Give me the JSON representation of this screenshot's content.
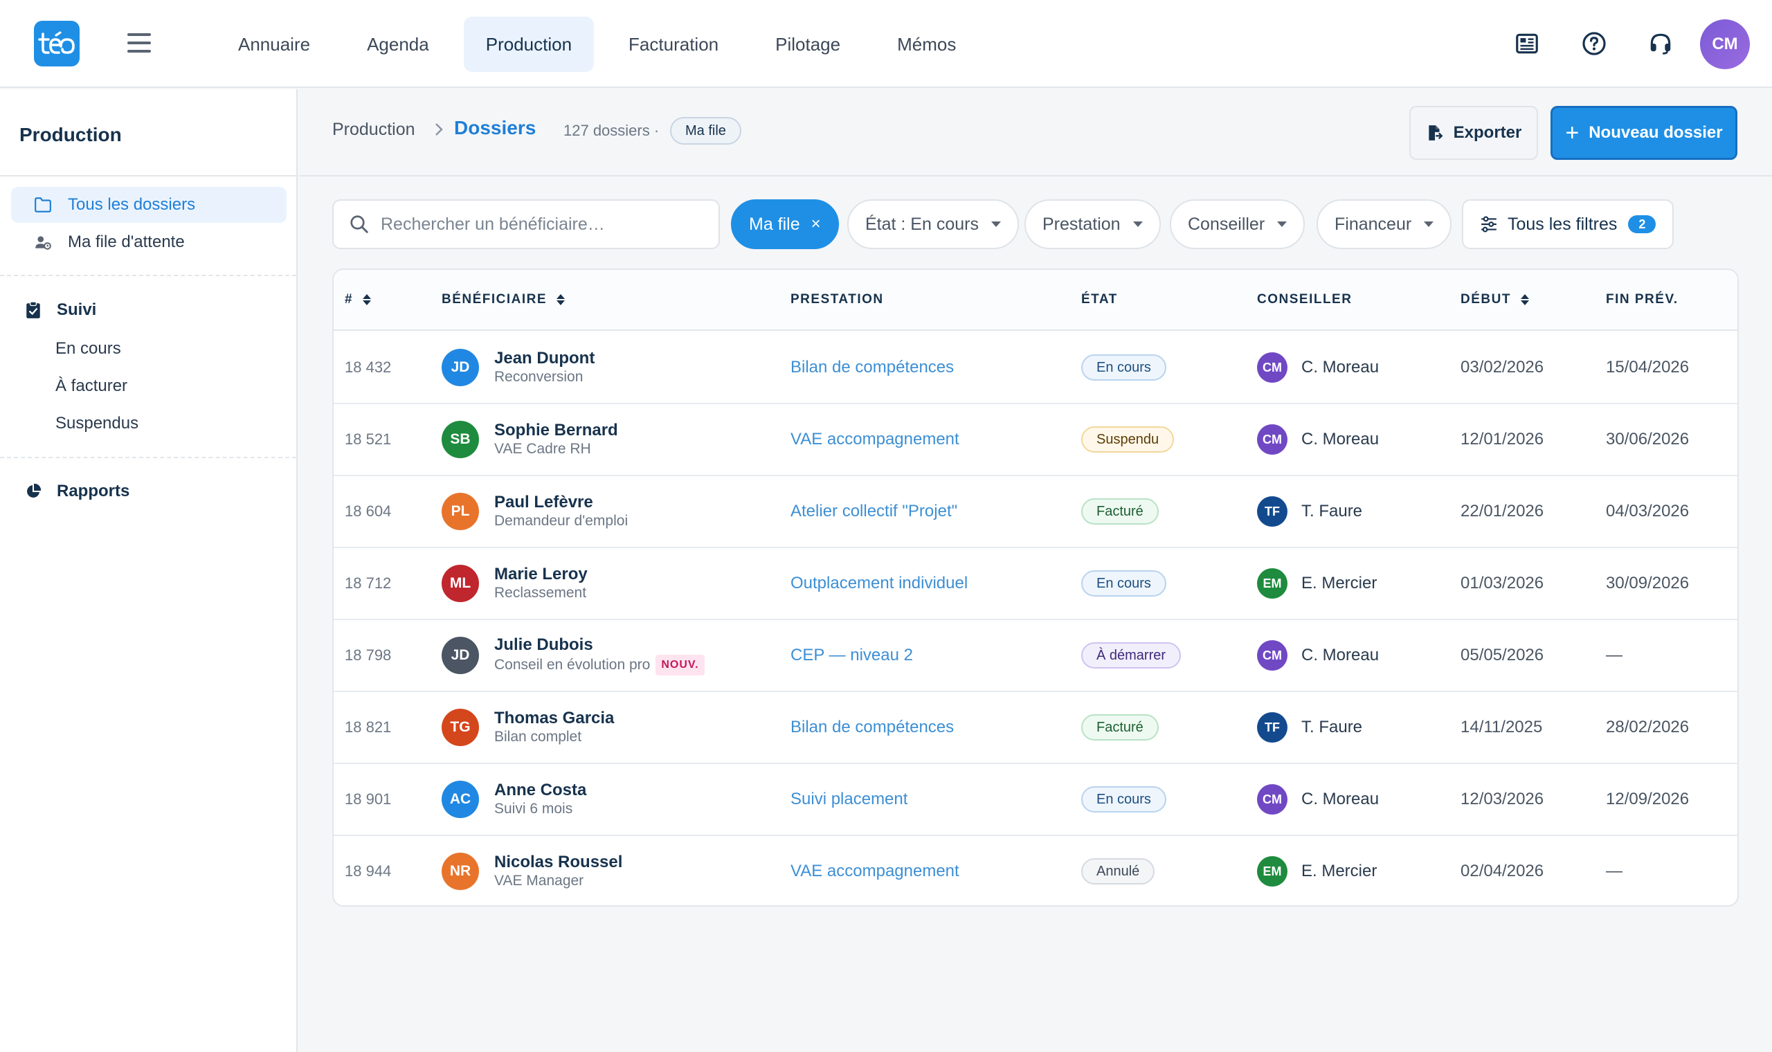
{
  "app": {
    "logo_text": "téo"
  },
  "nav": [
    {
      "label": "Annuaire",
      "active": false
    },
    {
      "label": "Agenda",
      "active": false
    },
    {
      "label": "Production",
      "active": true
    },
    {
      "label": "Facturation",
      "active": false
    },
    {
      "label": "Pilotage",
      "active": false
    },
    {
      "label": "Mémos",
      "active": false
    }
  ],
  "user": {
    "initials": "CM"
  },
  "sidebar": {
    "title": "Production",
    "items": [
      {
        "label": "Tous les dossiers",
        "icon": "folder-icon",
        "active": true
      },
      {
        "label": "Ma file d'attente",
        "icon": "user-queue-icon",
        "active": false
      }
    ],
    "groups": [
      {
        "label": "Suivi",
        "icon": "clipboard-check-icon",
        "children": [
          "En cours",
          "À facturer",
          "Suspendus"
        ]
      },
      {
        "label": "Rapports",
        "icon": "pie-chart-icon",
        "children": []
      }
    ]
  },
  "header": {
    "breadcrumb_root": "Production",
    "breadcrumb_current": "Dossiers",
    "count_text": "127 dossiers ·",
    "queue_pill": "Ma file",
    "export_label": "Exporter",
    "new_label": "Nouveau dossier"
  },
  "filters": {
    "search_placeholder": "Rechercher un bénéficiaire…",
    "active_chip": "Ma file",
    "chips": [
      "État : En cours",
      "Prestation",
      "Conseiller",
      "Financeur"
    ],
    "all_filters_label": "Tous les filtres",
    "all_filters_count": "2"
  },
  "table": {
    "columns": [
      "#",
      "BÉNÉFICIAIRE",
      "PRESTATION",
      "ÉTAT",
      "CONSEILLER",
      "DÉBUT",
      "FIN PRÉV."
    ],
    "rows": [
      {
        "num": "18 432",
        "initials": "JD",
        "avatar_color": "#2088e2",
        "name": "Jean Dupont",
        "sub": "Reconversion",
        "tag": "",
        "prestation": "Bilan de compétences",
        "etat": "En cours",
        "etat_style": "blue",
        "cons_initials": "CM",
        "cons_color": "#7048c4",
        "conseiller": "C. Moreau",
        "debut": "03/02/2026",
        "fin": "15/04/2026"
      },
      {
        "num": "18 521",
        "initials": "SB",
        "avatar_color": "#1e8b3e",
        "name": "Sophie Bernard",
        "sub": "VAE Cadre RH",
        "tag": "",
        "prestation": "VAE accompagnement",
        "etat": "Suspendu",
        "etat_style": "amber",
        "cons_initials": "CM",
        "cons_color": "#7048c4",
        "conseiller": "C. Moreau",
        "debut": "12/01/2026",
        "fin": "30/06/2026"
      },
      {
        "num": "18 604",
        "initials": "PL",
        "avatar_color": "#e8742c",
        "name": "Paul Lefèvre",
        "sub": "Demandeur d'emploi",
        "tag": "",
        "prestation": "Atelier collectif \"Projet\"",
        "etat": "Facturé",
        "etat_style": "green",
        "cons_initials": "TF",
        "cons_color": "#134a8e",
        "conseiller": "T. Faure",
        "debut": "22/01/2026",
        "fin": "04/03/2026"
      },
      {
        "num": "18 712",
        "initials": "ML",
        "avatar_color": "#c0262d",
        "name": "Marie Leroy",
        "sub": "Reclassement",
        "tag": "",
        "prestation": "Outplacement individuel",
        "etat": "En cours",
        "etat_style": "blue",
        "cons_initials": "EM",
        "cons_color": "#1e8b3e",
        "conseiller": "E. Mercier",
        "debut": "01/03/2026",
        "fin": "30/09/2026"
      },
      {
        "num": "18 798",
        "initials": "JD",
        "avatar_color": "#4b5563",
        "name": "Julie Dubois",
        "sub": "Conseil en évolution pro",
        "tag": "NOUV.",
        "prestation": "CEP — niveau 2",
        "etat": "À démarrer",
        "etat_style": "violet",
        "cons_initials": "CM",
        "cons_color": "#7048c4",
        "conseiller": "C. Moreau",
        "debut": "05/05/2026",
        "fin": "—"
      },
      {
        "num": "18 821",
        "initials": "TG",
        "avatar_color": "#d4461c",
        "name": "Thomas Garcia",
        "sub": "Bilan complet",
        "tag": "",
        "prestation": "Bilan de compétences",
        "etat": "Facturé",
        "etat_style": "green",
        "cons_initials": "TF",
        "cons_color": "#134a8e",
        "conseiller": "T. Faure",
        "debut": "14/11/2025",
        "fin": "28/02/2026"
      },
      {
        "num": "18 901",
        "initials": "AC",
        "avatar_color": "#2088e2",
        "name": "Anne Costa",
        "sub": "Suivi 6 mois",
        "tag": "",
        "prestation": "Suivi placement",
        "etat": "En cours",
        "etat_style": "blue",
        "cons_initials": "CM",
        "cons_color": "#7048c4",
        "conseiller": "C. Moreau",
        "debut": "12/03/2026",
        "fin": "12/09/2026"
      },
      {
        "num": "18 944",
        "initials": "NR",
        "avatar_color": "#e8742c",
        "name": "Nicolas Roussel",
        "sub": "VAE Manager",
        "tag": "",
        "prestation": "VAE accompagnement",
        "etat": "Annulé",
        "etat_style": "gray",
        "cons_initials": "EM",
        "cons_color": "#1e8b3e",
        "conseiller": "E. Mercier",
        "debut": "02/04/2026",
        "fin": "—"
      }
    ]
  },
  "colors": {
    "accent": "#1f8fe5",
    "link": "#3d8fd4",
    "text": "#17324d"
  }
}
